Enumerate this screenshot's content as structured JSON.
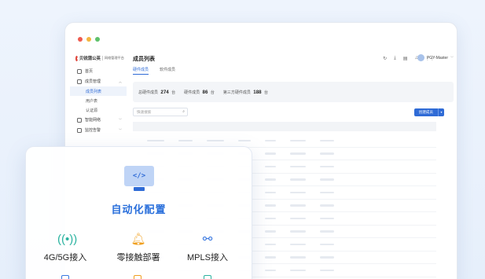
{
  "window_dots": [
    "#ef5b4f",
    "#f4b53f",
    "#5ec16b"
  ],
  "sidebar": {
    "brand_name": "贝锐蒲公英",
    "brand_sub": "网络管理平台",
    "items": [
      {
        "label": "首页",
        "icon": "home-icon"
      },
      {
        "label": "成员管理",
        "icon": "user-icon",
        "expanded": true
      },
      {
        "label": "智能网络",
        "icon": "network-icon"
      },
      {
        "label": "监控告警",
        "icon": "monitor-icon"
      }
    ],
    "sub_items": [
      {
        "label": "成员列表",
        "active": true
      },
      {
        "label": "用户表"
      },
      {
        "label": "认证源"
      }
    ]
  },
  "header": {
    "title": "成员列表",
    "user": "PGY-Master",
    "tools": [
      "refresh-icon",
      "download-icon",
      "grid-icon",
      "bell-icon",
      "apps-icon"
    ]
  },
  "tabs": [
    {
      "label": "硬件成员",
      "active": true
    },
    {
      "label": "软件成员"
    }
  ],
  "stats": [
    {
      "label": "总硬件成员",
      "value": "274",
      "unit": "台"
    },
    {
      "label": "硬件成员",
      "value": "86",
      "unit": "台"
    },
    {
      "label": "第三方硬件成员",
      "value": "188",
      "unit": "台"
    }
  ],
  "search": {
    "placeholder": "快速搜索"
  },
  "create_button": "创建成员",
  "accent": "#2f6bd6",
  "card": {
    "title": "自动化配置",
    "hero_icon": "code-monitor-icon",
    "features": [
      {
        "label": "4G/5G接入",
        "icon": "signal-tower-icon",
        "color": "#2bb3a0"
      },
      {
        "label": "零接触部署",
        "icon": "bell-deploy-icon",
        "color": "#f0a020"
      },
      {
        "label": "MPLS接入",
        "icon": "network-link-icon",
        "color": "#3a78e0"
      }
    ]
  }
}
